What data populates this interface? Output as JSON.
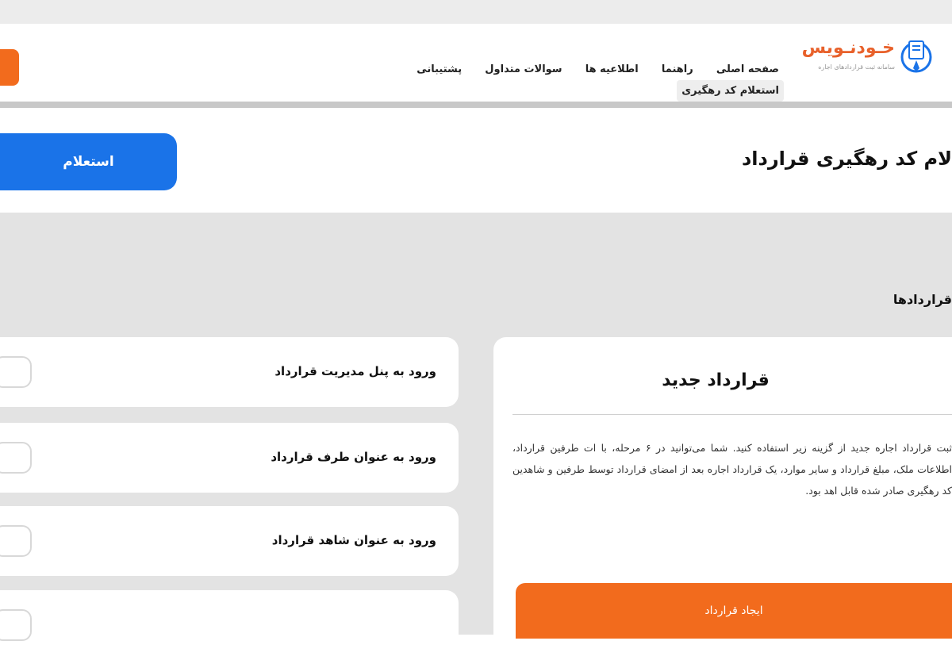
{
  "header": {
    "logo_text": "خـودنـویس",
    "logo_subtitle": "سامانه ثبت قراردادهای اجاره",
    "nav": [
      {
        "label": "صفحه اصلی",
        "active": false
      },
      {
        "label": "راهنما",
        "active": false
      },
      {
        "label": "اطلاعیه ها",
        "active": false
      },
      {
        "label": "سوالات متداول",
        "active": false
      },
      {
        "label": "پشتیبانی",
        "active": false
      },
      {
        "label": "استعلام کد رهگیری",
        "active": true
      }
    ]
  },
  "page": {
    "title": "لام کد رهگیری قرارداد",
    "inquiry_button": "استعلام",
    "section_title": "قراردادها"
  },
  "new_contract": {
    "title": "قرارداد جدید",
    "description": "ثبت قرارداد اجاره جدید از گزینه زیر استفاده کنید. شما می‌توانید در ۶ مرحله، با ات طرفین قرارداد، اطلاعات ملک، مبلغ قرارداد و سایر موارد، یک قرارداد اجاره بعد از امضای قرارداد توسط طرفین و شاهدین کد رهگیری صادر شده قابل اهد بود.",
    "button_label": "ایجاد قرارداد"
  },
  "options": [
    {
      "label": "ورود به پنل مدیریت قرارداد"
    },
    {
      "label": "ورود به عنوان طرف قرارداد"
    },
    {
      "label": "ورود به عنوان شاهد قرارداد"
    },
    {
      "label": ""
    }
  ],
  "colors": {
    "primary_blue": "#1a73e8",
    "accent_orange": "#f26b1d",
    "background_gray": "#e3e3e3"
  }
}
